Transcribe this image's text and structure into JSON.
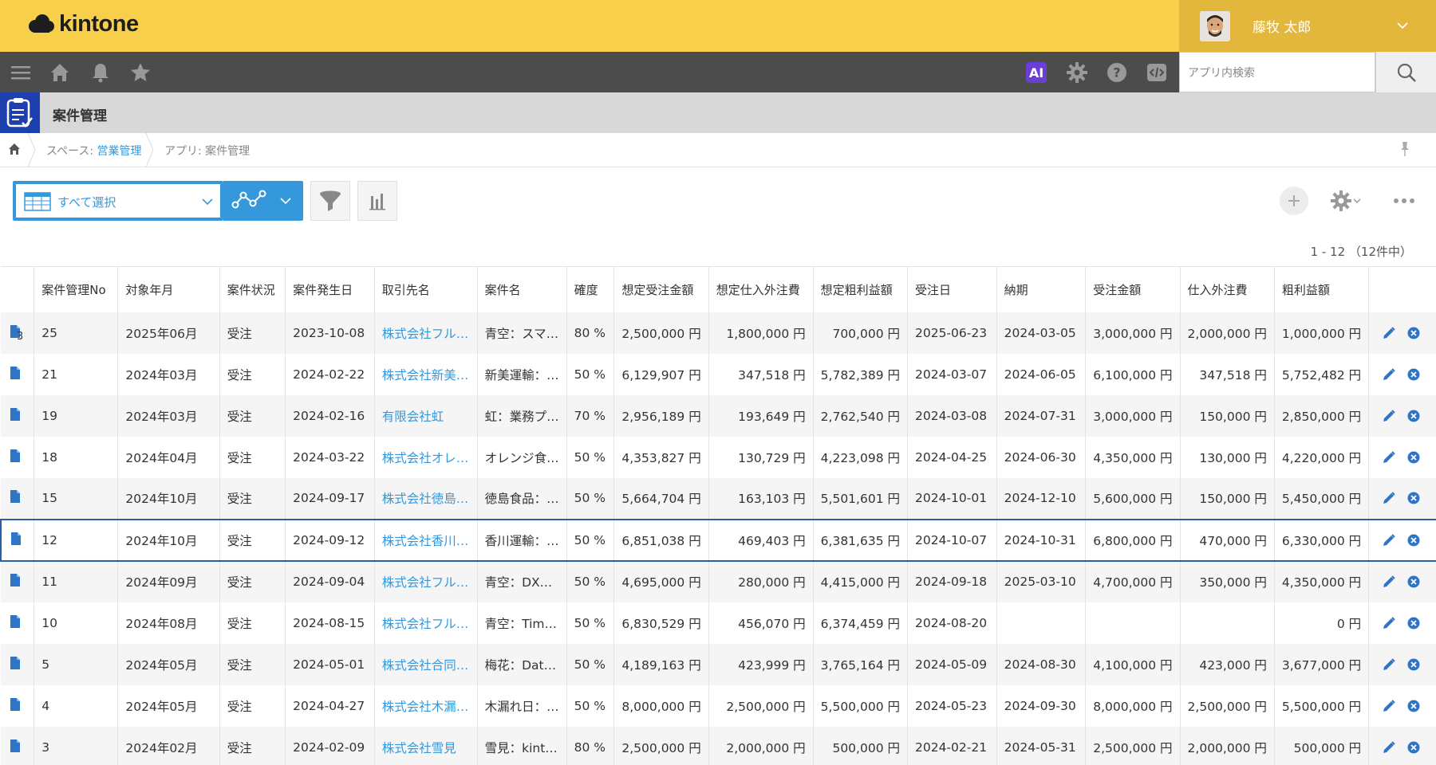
{
  "header": {
    "logo_text": "kintone",
    "user_name": "藤牧 太郎"
  },
  "navbar": {
    "ai_label": "AI",
    "search_placeholder": "アプリ内検索"
  },
  "app": {
    "title": "案件管理"
  },
  "breadcrumb": {
    "space_prefix": "スペース: ",
    "space_name": "営業管理",
    "app_text": "アプリ: 案件管理"
  },
  "toolbar": {
    "view_label": "すべて選択",
    "pager_text": "1 - 12 （12件中）"
  },
  "colors": {
    "header_yellow": "#f8cf4a",
    "nav_gray": "#4c4c4c",
    "accent_blue": "#3498db",
    "app_icon_blue": "#1e3fae"
  },
  "table": {
    "columns": [
      "案件管理No",
      "対象年月",
      "案件状況",
      "案件発生日",
      "取引先名",
      "案件名",
      "確度",
      "想定受注金額",
      "想定仕入外注費",
      "想定粗利益額",
      "受注日",
      "納期",
      "受注金額",
      "仕入外注費",
      "粗利益額"
    ],
    "rows": [
      {
        "count": "3",
        "no": "25",
        "ym": "2025年06月",
        "status": "受注",
        "date": "2023-10-08",
        "client": "株式会社フル…",
        "name": "青空：スマ…",
        "prob": "80 %",
        "est_order": "2,500,000 円",
        "est_cost": "1,800,000 円",
        "est_profit": "700,000 円",
        "order_date": "2025-06-23",
        "due": "2024-03-05",
        "order_amt": "3,000,000 円",
        "cost": "2,000,000 円",
        "profit": "1,000,000 円"
      },
      {
        "count": "",
        "no": "21",
        "ym": "2024年03月",
        "status": "受注",
        "date": "2024-02-22",
        "client": "株式会社新美…",
        "name": "新美運輸：…",
        "prob": "50 %",
        "est_order": "6,129,907 円",
        "est_cost": "347,518 円",
        "est_profit": "5,782,389 円",
        "order_date": "2024-03-07",
        "due": "2024-06-05",
        "order_amt": "6,100,000 円",
        "cost": "347,518 円",
        "profit": "5,752,482 円"
      },
      {
        "count": "",
        "no": "19",
        "ym": "2024年03月",
        "status": "受注",
        "date": "2024-02-16",
        "client": "有限会社虹",
        "name": "虹：業務プ…",
        "prob": "70 %",
        "est_order": "2,956,189 円",
        "est_cost": "193,649 円",
        "est_profit": "2,762,540 円",
        "order_date": "2024-03-08",
        "due": "2024-07-31",
        "order_amt": "3,000,000 円",
        "cost": "150,000 円",
        "profit": "2,850,000 円"
      },
      {
        "count": "",
        "no": "18",
        "ym": "2024年04月",
        "status": "受注",
        "date": "2024-03-22",
        "client": "株式会社オレ…",
        "name": "オレンジ食…",
        "prob": "50 %",
        "est_order": "4,353,827 円",
        "est_cost": "130,729 円",
        "est_profit": "4,223,098 円",
        "order_date": "2024-04-25",
        "due": "2024-06-30",
        "order_amt": "4,350,000 円",
        "cost": "130,000 円",
        "profit": "4,220,000 円"
      },
      {
        "count": "",
        "no": "15",
        "ym": "2024年10月",
        "status": "受注",
        "date": "2024-09-17",
        "client": "株式会社徳島…",
        "name": "徳島食品：…",
        "prob": "50 %",
        "est_order": "5,664,704 円",
        "est_cost": "163,103 円",
        "est_profit": "5,501,601 円",
        "order_date": "2024-10-01",
        "due": "2024-12-10",
        "order_amt": "5,600,000 円",
        "cost": "150,000 円",
        "profit": "5,450,000 円"
      },
      {
        "count": "",
        "no": "12",
        "ym": "2024年10月",
        "status": "受注",
        "date": "2024-09-12",
        "client": "株式会社香川…",
        "name": "香川運輸：…",
        "prob": "50 %",
        "est_order": "6,851,038 円",
        "est_cost": "469,403 円",
        "est_profit": "6,381,635 円",
        "order_date": "2024-10-07",
        "due": "2024-10-31",
        "order_amt": "6,800,000 円",
        "cost": "470,000 円",
        "profit": "6,330,000 円"
      },
      {
        "count": "",
        "no": "11",
        "ym": "2024年09月",
        "status": "受注",
        "date": "2024-09-04",
        "client": "株式会社フル…",
        "name": "青空：DX…",
        "prob": "50 %",
        "est_order": "4,695,000 円",
        "est_cost": "280,000 円",
        "est_profit": "4,415,000 円",
        "order_date": "2024-09-18",
        "due": "2025-03-10",
        "order_amt": "4,700,000 円",
        "cost": "350,000 円",
        "profit": "4,350,000 円"
      },
      {
        "count": "",
        "no": "10",
        "ym": "2024年08月",
        "status": "受注",
        "date": "2024-08-15",
        "client": "株式会社フル…",
        "name": "青空：Tim…",
        "prob": "50 %",
        "est_order": "6,830,529 円",
        "est_cost": "456,070 円",
        "est_profit": "6,374,459 円",
        "order_date": "2024-08-20",
        "due": "",
        "order_amt": "",
        "cost": "",
        "profit": "0 円"
      },
      {
        "count": "",
        "no": "5",
        "ym": "2024年05月",
        "status": "受注",
        "date": "2024-05-01",
        "client": "株式会社合同…",
        "name": "梅花：Dat…",
        "prob": "50 %",
        "est_order": "4,189,163 円",
        "est_cost": "423,999 円",
        "est_profit": "3,765,164 円",
        "order_date": "2024-05-09",
        "due": "2024-08-30",
        "order_amt": "4,100,000 円",
        "cost": "423,000 円",
        "profit": "3,677,000 円"
      },
      {
        "count": "",
        "no": "4",
        "ym": "2024年05月",
        "status": "受注",
        "date": "2024-04-27",
        "client": "株式会社木漏…",
        "name": "木漏れ日：…",
        "prob": "50 %",
        "est_order": "8,000,000 円",
        "est_cost": "2,500,000 円",
        "est_profit": "5,500,000 円",
        "order_date": "2024-05-23",
        "due": "2024-09-30",
        "order_amt": "8,000,000 円",
        "cost": "2,500,000 円",
        "profit": "5,500,000 円"
      },
      {
        "count": "",
        "no": "3",
        "ym": "2024年02月",
        "status": "受注",
        "date": "2024-02-09",
        "client": "株式会社雪見",
        "name": "雪見：kint…",
        "prob": "80 %",
        "est_order": "2,500,000 円",
        "est_cost": "2,000,000 円",
        "est_profit": "500,000 円",
        "order_date": "2024-02-21",
        "due": "2024-05-31",
        "order_amt": "2,500,000 円",
        "cost": "2,000,000 円",
        "profit": "500,000 円"
      }
    ]
  }
}
